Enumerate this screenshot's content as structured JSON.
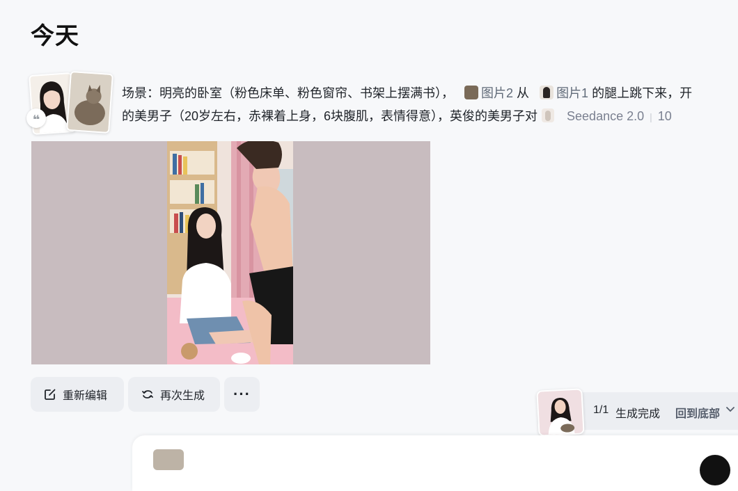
{
  "section": {
    "title": "今天"
  },
  "prompt": {
    "line1_text": "场景：明亮的卧室（粉色床单、粉色窗帘、书架上摆满书），",
    "ref_image2": "图片2",
    "connector_from": "从",
    "ref_image1": "图片1",
    "line1_tail": "的腿上跳下来，开",
    "line2_text": "的美男子（20岁左右，赤裸着上身，6块腹肌，表情得意），英俊的美男子对",
    "model": "Seedance 2.0",
    "meta_tail": "10"
  },
  "actions": {
    "edit_label": "重新编辑",
    "regen_label": "再次生成",
    "more_label": "···"
  },
  "status": {
    "count": "1/1",
    "text": "生成完成",
    "link": "回到底部"
  }
}
